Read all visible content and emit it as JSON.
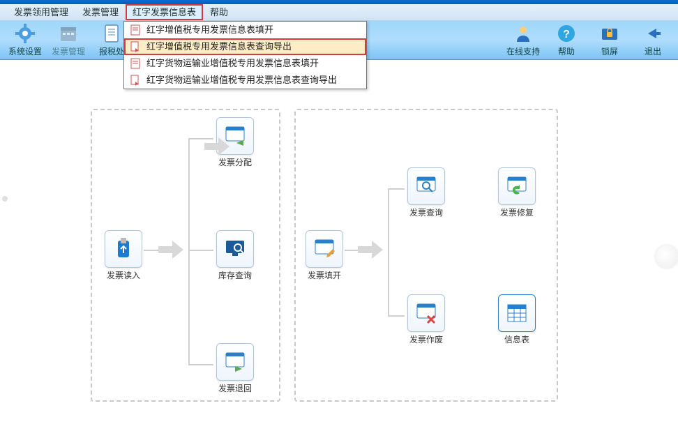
{
  "menu": {
    "items": [
      "发票领用管理",
      "发票管理",
      "红字发票信息表",
      "帮助"
    ],
    "highlighted_index": 2
  },
  "toolbar": {
    "left": [
      {
        "name": "sys-settings",
        "label": "系统设置",
        "icon": "gear"
      },
      {
        "name": "invoice-mgmt",
        "label": "发票管理",
        "icon": "calendar",
        "dimmed": true
      },
      {
        "name": "tax-report",
        "label": "报税处",
        "icon": "doc"
      }
    ],
    "right": [
      {
        "name": "online-support",
        "label": "在线支持",
        "icon": "person"
      },
      {
        "name": "help",
        "label": "帮助",
        "icon": "help"
      },
      {
        "name": "lock",
        "label": "锁屏",
        "icon": "lock"
      },
      {
        "name": "exit",
        "label": "退出",
        "icon": "back"
      }
    ]
  },
  "dropdown": {
    "items": [
      "红字增值税专用发票信息表填开",
      "红字增值税专用发票信息表查询导出",
      "红字货物运输业增值税专用发票信息表填开",
      "红字货物运输业增值税专用发票信息表查询导出"
    ],
    "selected_index": 1
  },
  "flow": {
    "panel_a": {
      "read_in": "发票读入",
      "alloc": "发票分配",
      "stock_query": "库存查询",
      "return": "发票退回"
    },
    "panel_b": {
      "fill": "发票填开",
      "query": "发票查询",
      "repair": "发票修复",
      "void": "发票作废",
      "info_table": "信息表"
    }
  }
}
